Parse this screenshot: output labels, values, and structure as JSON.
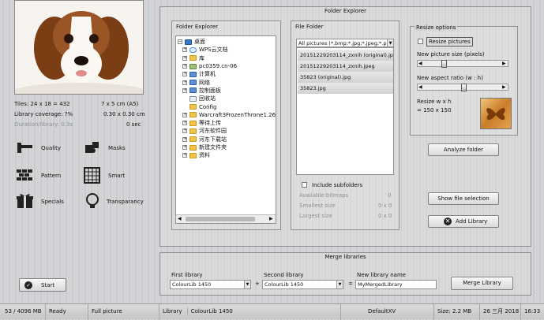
{
  "left": {
    "tiles": "Tiles: 24 x 18 = 432",
    "tiles_size": "7 x 5 cm  (A5)",
    "coverage": "Library coverage: ?%",
    "coverage_size": "0.30 x 0.30 cm",
    "time_label": "Duration/library: 0.3s",
    "time_value": "0 sec",
    "tools": [
      {
        "label": "Quality",
        "icon": "quality-icon"
      },
      {
        "label": "Masks",
        "icon": "masks-icon"
      },
      {
        "label": "Pattern",
        "icon": "pattern-icon"
      },
      {
        "label": "Smart",
        "icon": "smart-icon"
      },
      {
        "label": "Specials",
        "icon": "specials-icon"
      },
      {
        "label": "Transparancy",
        "icon": "transparency-icon"
      }
    ],
    "start": "Start"
  },
  "explorer": {
    "title": "Folder Explorer",
    "folder_title": "Folder Explorer",
    "tree": [
      {
        "label": "桌面",
        "icon": "desktop-icon",
        "root": true
      },
      {
        "label": "WPS云文档",
        "icon": "cloud-icon"
      },
      {
        "label": "库",
        "icon": "folder-icon"
      },
      {
        "label": "pc0359.cn-06",
        "icon": "user-icon"
      },
      {
        "label": "计算机",
        "icon": "computer-icon"
      },
      {
        "label": "网络",
        "icon": "network-icon"
      },
      {
        "label": "控制面板",
        "icon": "control-panel-icon"
      },
      {
        "label": "回收站",
        "icon": "recycle-bin-icon"
      },
      {
        "label": "Config",
        "icon": "folder-icon"
      },
      {
        "label": "Warcraft3FrozenThrone1.26_",
        "icon": "folder-icon"
      },
      {
        "label": "等待上传",
        "icon": "folder-icon"
      },
      {
        "label": "河东软件园",
        "icon": "folder-icon"
      },
      {
        "label": "河东下载站",
        "icon": "folder-icon"
      },
      {
        "label": "新建文件夹",
        "icon": "folder-icon"
      },
      {
        "label": "资料",
        "icon": "folder-icon"
      }
    ],
    "file_title": "File Folder",
    "filter": "All pictures (*.bmp;*.jpg;*.jpeg;*.p",
    "files": [
      "20151229203114_zxnih (original).jpe",
      "20151229203114_zxnih.jpeg",
      "35823 (original).jpg",
      "35823.jpg"
    ],
    "include_subfolders": "Include subfolders",
    "available": "Available bitmaps",
    "available_v": "0",
    "smallest": "Smallest size",
    "smallest_v": "0 x 0",
    "largest": "Largest size",
    "largest_v": "0 x 0"
  },
  "resize": {
    "title": "Resize options",
    "checkbox": "Resize pictures",
    "size_label": "New picture size (pixels)",
    "aspect_label": "New aspect ratio (w : h)",
    "resize_label": "Resize w x h",
    "resize_value": "= 150 x 150",
    "analyze": "Analyze folder",
    "show": "Show file selection",
    "add": "Add Library"
  },
  "merge": {
    "title": "Merge libraries",
    "first_label": "First library",
    "first_value": "ColourLib 1450",
    "second_label": "Second library",
    "second_value": "ColourLib 1450",
    "new_label": "New library name",
    "new_value": "MyMergedLibrary",
    "plus": "+",
    "equals": "=",
    "button": "Merge Library"
  },
  "status": {
    "memory": "53 / 4096 MB",
    "state": "Ready",
    "picture": "Full picture",
    "library_label": "Library",
    "library": "ColourLib 1450",
    "theme": "DefaultXV",
    "size": "Size: 2.2 MB",
    "date": "26 三月 2018",
    "time": "16:33"
  }
}
